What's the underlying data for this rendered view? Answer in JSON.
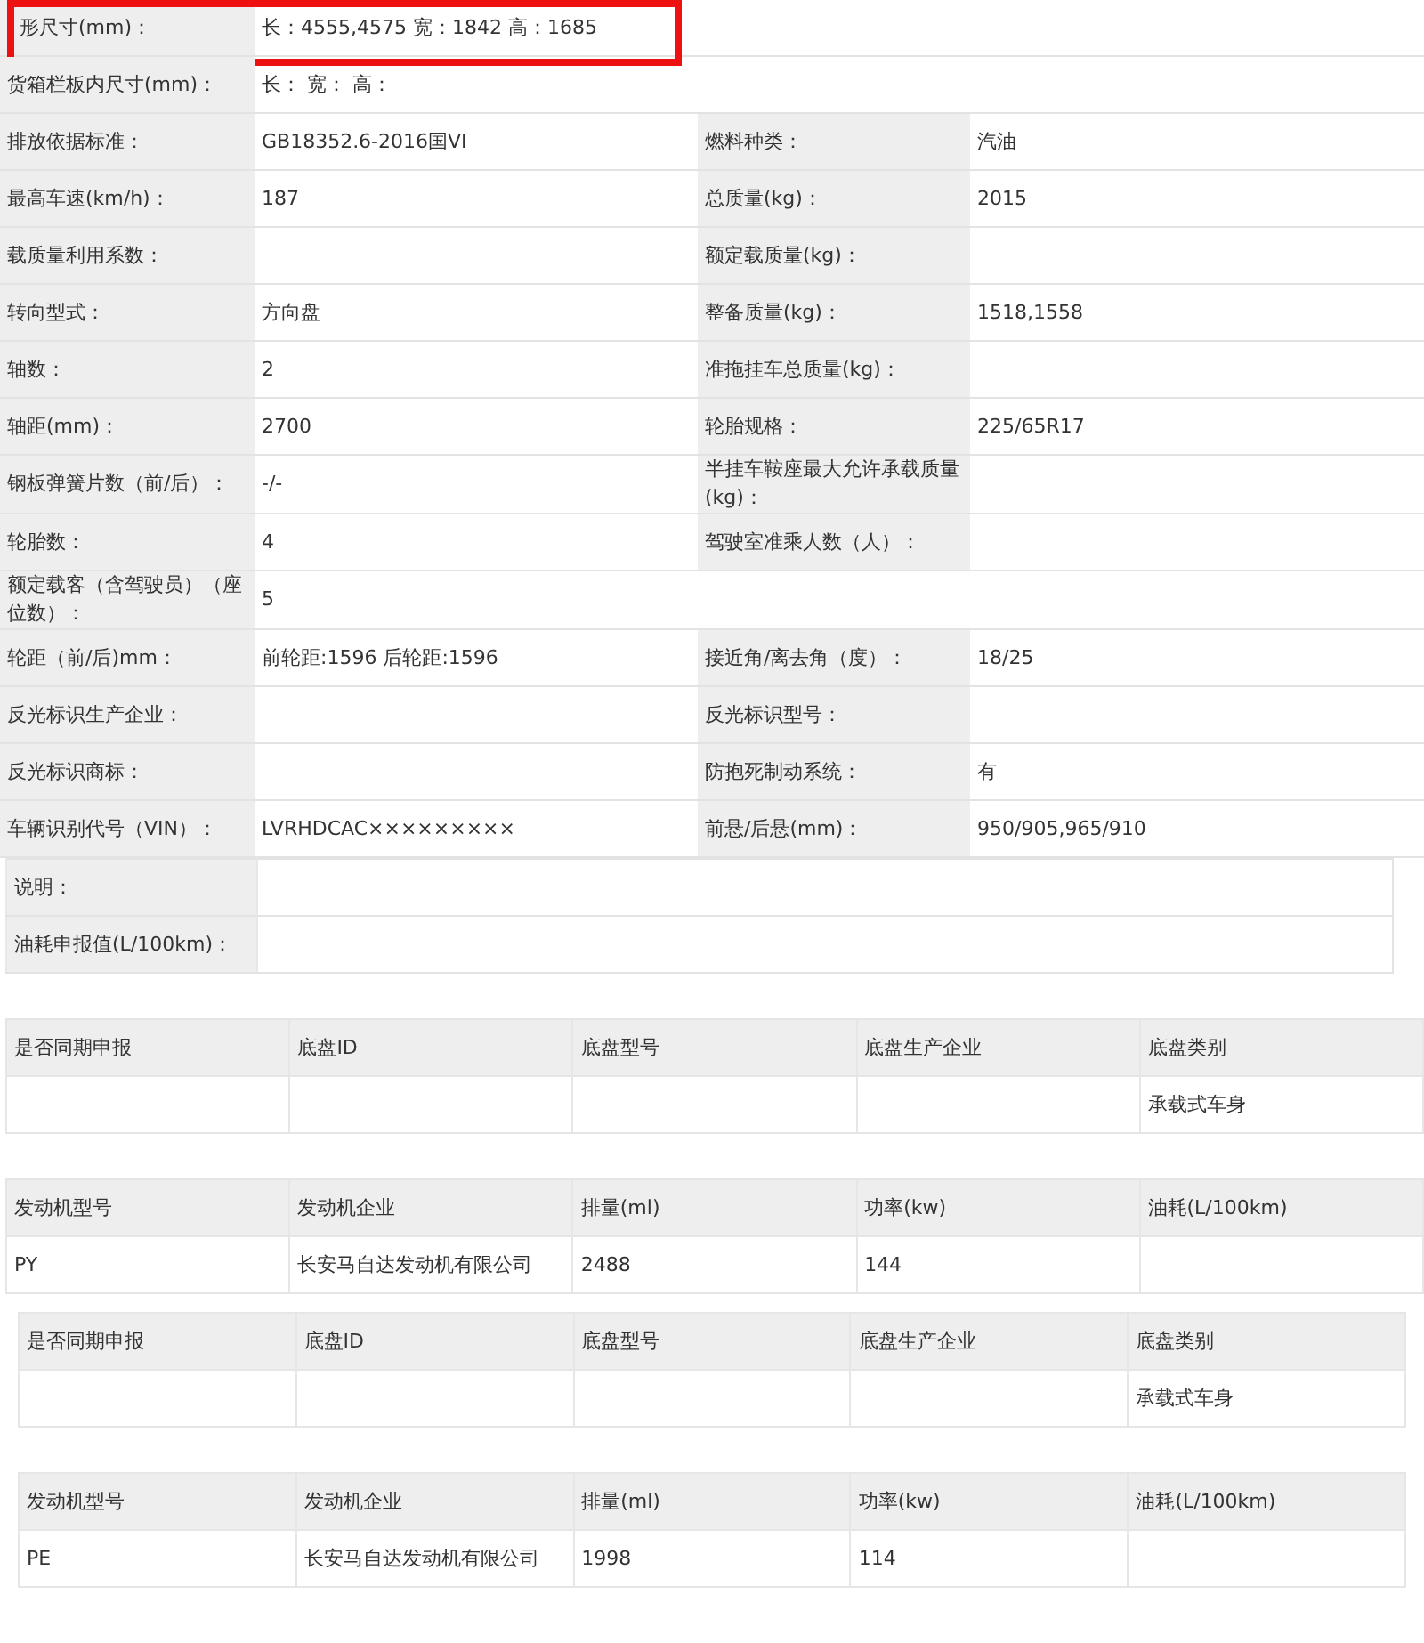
{
  "spec_rows": [
    {
      "kind": "wide",
      "label": "形尺寸(mm)：",
      "value": "长：4555,4575 宽：1842 高：1685",
      "highlighted": true
    },
    {
      "kind": "wide",
      "label": "货箱栏板内尺寸(mm)：",
      "value": "长： 宽： 高：",
      "highlighted": false
    },
    {
      "kind": "pair",
      "label": "排放依据标准：",
      "value": "GB18352.6-2016国VI",
      "label_2": "燃料种类：",
      "value_2": "汽油"
    },
    {
      "kind": "pair",
      "label": "最高车速(km/h)：",
      "value": "187",
      "label_2": "总质量(kg)：",
      "value_2": "2015"
    },
    {
      "kind": "pair",
      "label": "载质量利用系数：",
      "label_2": "额定载质量(kg)："
    },
    {
      "kind": "pair",
      "label": "转向型式：",
      "value": "方向盘",
      "label_2": "整备质量(kg)：",
      "value_2": "1518,1558"
    },
    {
      "kind": "pair",
      "label": "轴数：",
      "value": "2",
      "label_2": "准拖挂车总质量(kg)："
    },
    {
      "kind": "pair",
      "label": "轴距(mm)：",
      "value": "2700",
      "label_2": "轮胎规格：",
      "value_2": "225/65R17"
    },
    {
      "kind": "pair",
      "label": "钢板弹簧片数（前/后）：",
      "value": "-/-",
      "label_2": "半挂车鞍座最大允许承载质量(kg)："
    },
    {
      "kind": "pair",
      "label": "轮胎数：",
      "value": "4",
      "label_2": "驾驶室准乘人数（人）："
    },
    {
      "kind": "wide",
      "label": "额定载客（含驾驶员）（座位数）：",
      "value": "5",
      "highlighted": false
    },
    {
      "kind": "pair",
      "label": "轮距（前/后)mm：",
      "value": "前轮距:1596 后轮距:1596",
      "label_2": "接近角/离去角（度）：",
      "value_2": "18/25"
    },
    {
      "kind": "pair",
      "label": "反光标识生产企业：",
      "label_2": "反光标识型号："
    },
    {
      "kind": "pair",
      "label": "反光标识商标：",
      "label_2": "防抱死制动系统：",
      "value_2": "有"
    },
    {
      "kind": "pair",
      "label": "车辆识别代号（VIN）：",
      "value": "LVRHDCAC×××××××××",
      "label_2": "前悬/后悬(mm)：",
      "value_2": "950/905,965/910"
    },
    {
      "kind": "note",
      "label": "说明："
    },
    {
      "kind": "note",
      "label": "油耗申报值(L/100km)："
    }
  ],
  "blocks": [
    {
      "inset": false,
      "tables": [
        {
          "columns": [
            "是否同期申报",
            "底盘ID",
            "底盘型号",
            "底盘生产企业",
            "底盘类别"
          ],
          "rows": [
            [
              null,
              null,
              null,
              null,
              "承载式车身"
            ]
          ]
        },
        {
          "columns": [
            "发动机型号",
            "发动机企业",
            "排量(ml)",
            "功率(kw)",
            "油耗(L/100km)"
          ],
          "rows": [
            [
              "PY",
              "长安马自达发动机有限公司",
              "2488",
              "144",
              null
            ]
          ]
        }
      ]
    },
    {
      "inset": true,
      "tables": [
        {
          "columns": [
            "是否同期申报",
            "底盘ID",
            "底盘型号",
            "底盘生产企业",
            "底盘类别"
          ],
          "rows": [
            [
              null,
              null,
              null,
              null,
              "承载式车身"
            ]
          ]
        },
        {
          "columns": [
            "发动机型号",
            "发动机企业",
            "排量(ml)",
            "功率(kw)",
            "油耗(L/100km)"
          ],
          "rows": [
            [
              "PE",
              "长安马自达发动机有限公司",
              "1998",
              "114",
              null
            ]
          ]
        }
      ]
    }
  ]
}
